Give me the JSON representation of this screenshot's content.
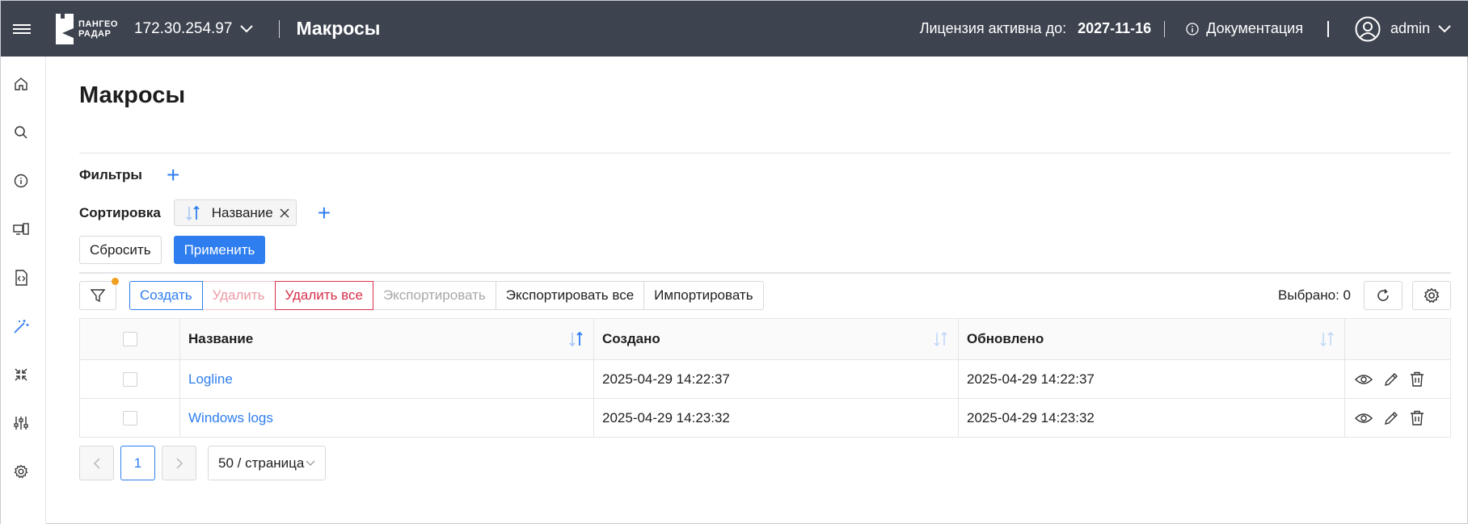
{
  "header": {
    "logo_line1": "ПАНГЕО",
    "logo_line2": "РАДАР",
    "host": "172.30.254.97",
    "app_title": "Макросы",
    "license_label": "Лицензия активна до:",
    "license_date": "2027-11-16",
    "docs_label": "Документация",
    "username": "admin"
  },
  "sidebar": {
    "items": [
      "home-icon",
      "search-icon",
      "info-icon",
      "devices-icon",
      "code-file-icon",
      "magic-wand-icon",
      "collapse-icon",
      "sliders-icon",
      "gear-icon"
    ],
    "active": "magic-wand-icon"
  },
  "page": {
    "title": "Макросы",
    "filters_label": "Фильтры",
    "sort_label": "Сортировка",
    "sort_tag": "Название",
    "reset_label": "Сбросить",
    "apply_label": "Применить"
  },
  "toolbar": {
    "create": "Создать",
    "delete": "Удалить",
    "delete_all": "Удалить все",
    "export": "Экспортировать",
    "export_all": "Экспортировать все",
    "import": "Импортировать",
    "selected": "Выбрано: 0"
  },
  "table": {
    "columns": [
      "Название",
      "Создано",
      "Обновлено"
    ],
    "rows": [
      {
        "name": "Logline",
        "created": "2025-04-29 14:22:37",
        "updated": "2025-04-29 14:22:37"
      },
      {
        "name": "Windows logs",
        "created": "2025-04-29 14:23:32",
        "updated": "2025-04-29 14:23:32"
      }
    ]
  },
  "pagination": {
    "page": "1",
    "page_size": "50 / страница"
  },
  "colors": {
    "header_bg": "#3d434f",
    "accent": "#2f7ef0",
    "danger": "#d6304a",
    "badge": "#f0a020"
  }
}
